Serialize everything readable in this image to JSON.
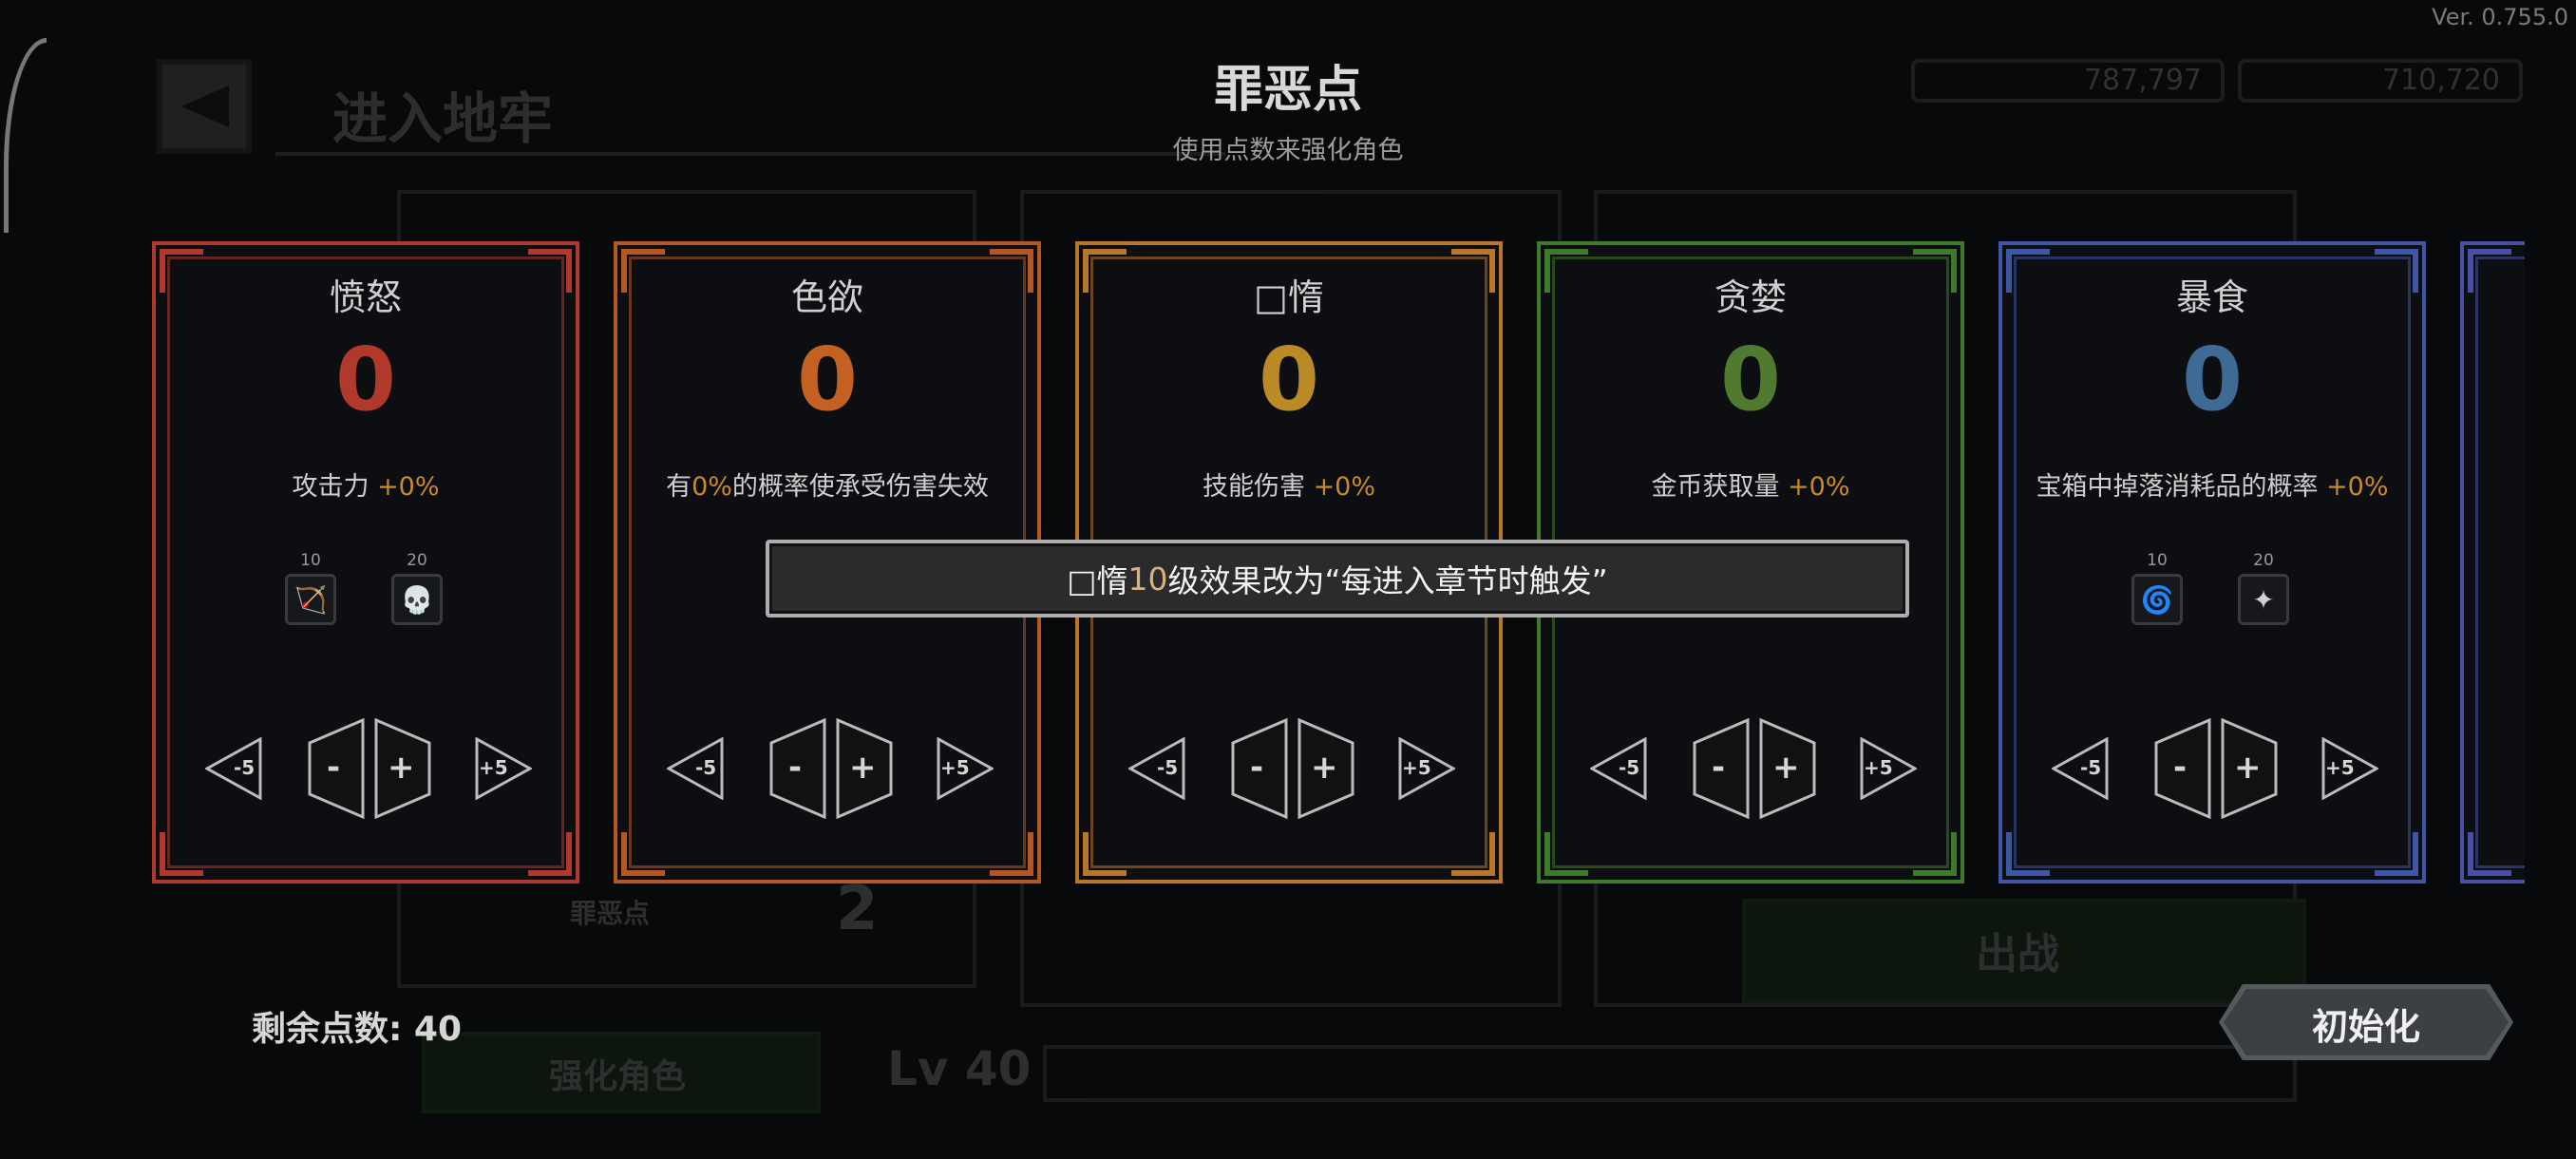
{
  "version": "Ver. 0.755.0",
  "header": {
    "title": "罪恶点",
    "subtitle": "使用点数来强化角色"
  },
  "background": {
    "screen_title": "进入地牢",
    "currency_1": "787,797",
    "currency_2": "710,720",
    "panel_label": "罪恶点",
    "panel_value": "2",
    "start_label": "出战",
    "upgrade_label": "强化角色",
    "level_label": "Lv 40"
  },
  "cards": [
    {
      "name": "愤怒",
      "value": "0",
      "desc_pre": "攻击力 ",
      "desc_pct": "+0%",
      "desc_post": "",
      "color": "#b0392b",
      "value_color": "#b0392b",
      "lvl1": "10",
      "lvl2": "20",
      "skill1": "🏹",
      "skill2": "💀"
    },
    {
      "name": "色欲",
      "value": "0",
      "desc_pre": "有",
      "desc_pct": "0%",
      "desc_post": "的概率使承受伤害失效",
      "color": "#b55722",
      "value_color": "#c46022",
      "lvl1": "",
      "lvl2": "",
      "skill1": "",
      "skill2": ""
    },
    {
      "name": "□惰",
      "value": "0",
      "desc_pre": "技能伤害 ",
      "desc_pct": "+0%",
      "desc_post": "",
      "color": "#b8762a",
      "value_color": "#b98a26",
      "lvl1": "",
      "lvl2": "",
      "skill1": "",
      "skill2": ""
    },
    {
      "name": "贪婪",
      "value": "0",
      "desc_pre": "金币获取量 ",
      "desc_pct": "+0%",
      "desc_post": "",
      "color": "#3f7a2a",
      "value_color": "#4f7a2f",
      "lvl1": "",
      "lvl2": "",
      "skill1": "",
      "skill2": ""
    },
    {
      "name": "暴食",
      "value": "0",
      "desc_pre": "宝箱中掉落消耗品的概率 ",
      "desc_pct": "+0%",
      "desc_post": "",
      "color": "#3d57a6",
      "value_color": "#3f6a96",
      "lvl1": "10",
      "lvl2": "20",
      "skill1": "🌀",
      "skill2": "✦"
    },
    {
      "name": "",
      "value": "",
      "desc_pre": "",
      "desc_pct": "",
      "desc_post": "",
      "color": "#4a4fa6",
      "value_color": "#4a4fa6",
      "lvl1": "",
      "lvl2": "",
      "skill1": "",
      "skill2": ""
    }
  ],
  "controls": {
    "minus5": "-5",
    "minus": "-",
    "plus": "+",
    "plus5": "+5"
  },
  "remaining_points": "剩余点数: 40",
  "reset_label": "初始化",
  "toast": {
    "pre": "□惰",
    "num": "10",
    "post": "级效果改为“每进入章节时触发”"
  }
}
